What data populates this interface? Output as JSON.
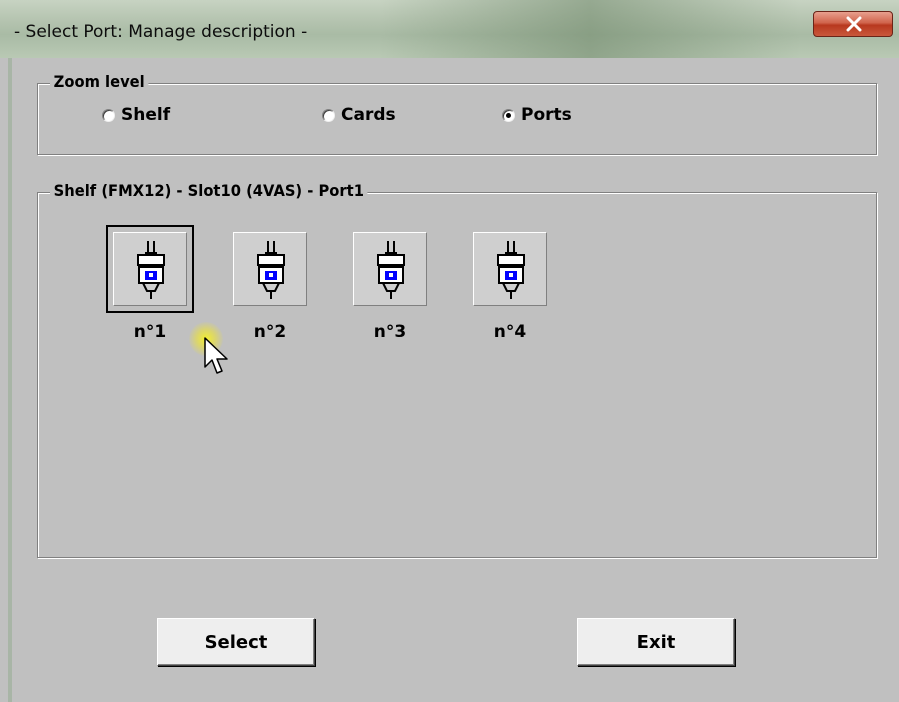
{
  "window": {
    "title": "- Select Port: Manage description -"
  },
  "zoom": {
    "label": "Zoom level",
    "options": [
      {
        "label": "Shelf",
        "selected": false
      },
      {
        "label": "Cards",
        "selected": false
      },
      {
        "label": "Ports",
        "selected": true
      }
    ]
  },
  "location": {
    "label": "Shelf (FMX12) - Slot10 (4VAS) - Port1",
    "ports": [
      {
        "label": "n°1",
        "selected": true,
        "icon": "port-connector-icon"
      },
      {
        "label": "n°2",
        "selected": false,
        "icon": "port-connector-icon"
      },
      {
        "label": "n°3",
        "selected": false,
        "icon": "port-connector-icon"
      },
      {
        "label": "n°4",
        "selected": false,
        "icon": "port-connector-icon"
      }
    ]
  },
  "buttons": {
    "select": "Select",
    "exit": "Exit"
  },
  "colors": {
    "dialog_bg": "#c0c0c0",
    "close_button": "#c9583c",
    "port_indicator": "#0000ff"
  }
}
